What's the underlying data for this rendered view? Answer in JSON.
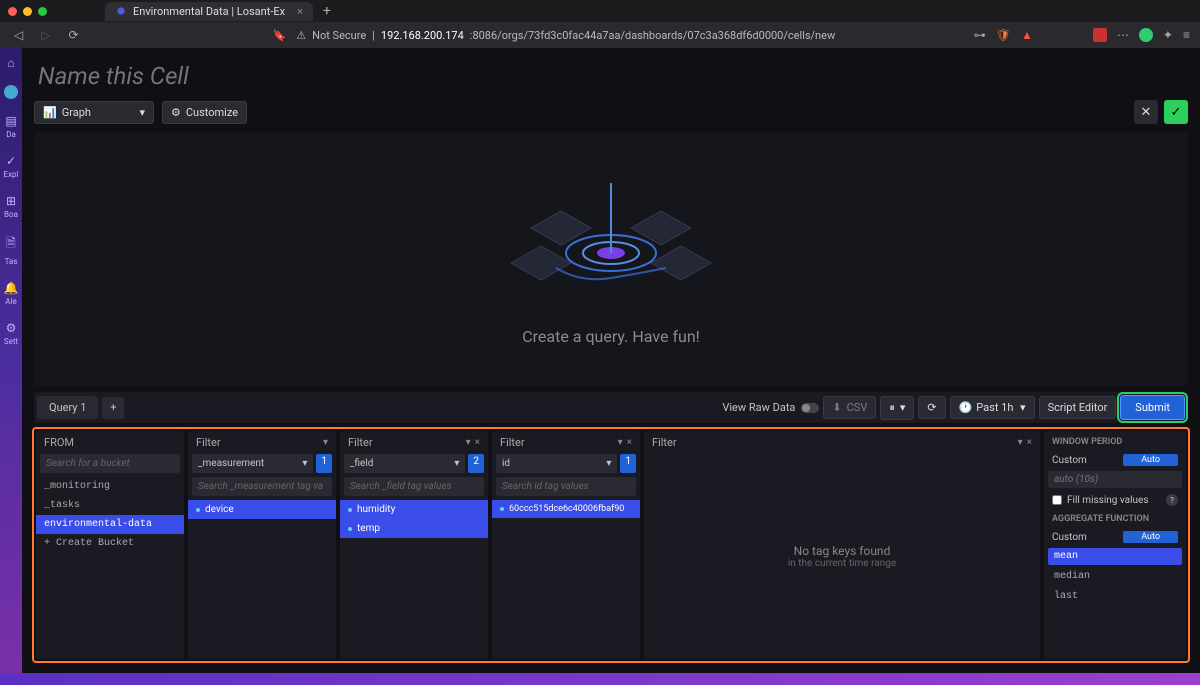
{
  "browser": {
    "tab_title": "Environmental Data | Losant-Ex",
    "security_text": "Not Secure",
    "url_host": "192.168.200.174",
    "url_path": ":8086/orgs/73fd3c0fac44a7aa/dashboards/07c3a368df6d0000/cells/new"
  },
  "sidebar": {
    "items": [
      {
        "icon": "⌂",
        "label": ""
      },
      {
        "icon": "👤",
        "label": ""
      },
      {
        "icon": "▤",
        "label": "Da"
      },
      {
        "icon": "✓",
        "label": "Expl"
      },
      {
        "icon": "⊞",
        "label": "Boa"
      },
      {
        "icon": "🗎",
        "label": "Tas"
      },
      {
        "icon": "🔔",
        "label": "Ale"
      },
      {
        "icon": "⚙",
        "label": "Sett"
      }
    ]
  },
  "cell": {
    "title_placeholder": "Name this Cell",
    "viz_type": "Graph",
    "customize": "Customize",
    "placeholder_text": "Create a query. Have fun!"
  },
  "query_bar": {
    "tab": "Query 1",
    "view_raw": "View Raw Data",
    "csv": "CSV",
    "time_range": "Past 1h",
    "script_editor": "Script Editor",
    "submit": "Submit"
  },
  "builder": {
    "from": {
      "label": "FROM",
      "search_placeholder": "Search for a bucket",
      "items": [
        "_monitoring",
        "_tasks",
        "environmental-data",
        "+ Create Bucket"
      ],
      "selected": "environmental-data"
    },
    "filters": [
      {
        "label": "Filter",
        "tag_key": "_measurement",
        "count": "1",
        "search_placeholder": "Search _measurement tag va",
        "values": [
          "device"
        ],
        "selected": [
          "device"
        ]
      },
      {
        "label": "Filter",
        "tag_key": "_field",
        "count": "2",
        "search_placeholder": "Search _field tag values",
        "values": [
          "humidity",
          "temp"
        ],
        "selected": [
          "humidity",
          "temp"
        ]
      },
      {
        "label": "Filter",
        "tag_key": "id",
        "count": "1",
        "search_placeholder": "Search id tag values",
        "values": [
          "60ccc515dce6c40006fbaf90"
        ],
        "selected": [
          "60ccc515dce6c40006fbaf90"
        ]
      }
    ],
    "empty_filter": {
      "label": "Filter",
      "no_keys": "No tag keys found",
      "sub": "in the current time range"
    }
  },
  "rpanel": {
    "window_period": "WINDOW PERIOD",
    "custom": "Custom",
    "auto": "Auto",
    "period_value": "auto (10s)",
    "fill_missing": "Fill missing values",
    "agg_fn": "AGGREGATE FUNCTION",
    "agg_items": [
      "mean",
      "median",
      "last"
    ],
    "agg_selected": "mean"
  }
}
